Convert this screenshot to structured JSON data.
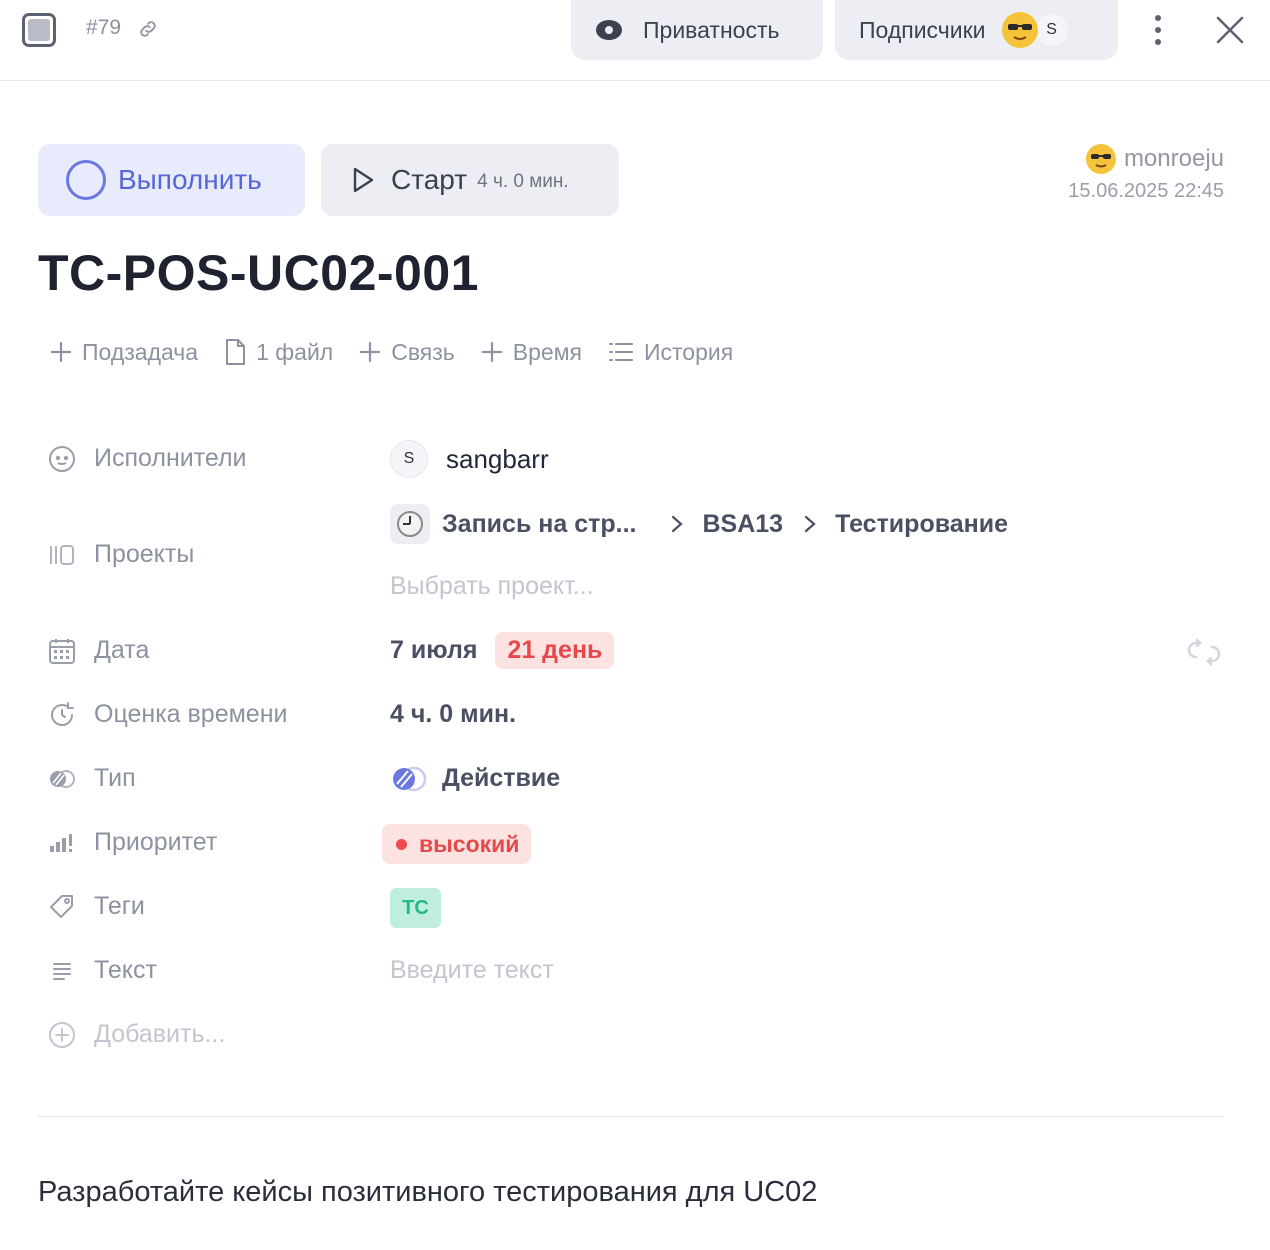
{
  "header": {
    "task_number": "#79",
    "privacy_label": "Приватность",
    "subscribers_label": "Подписчики",
    "subscriber_initial": "S"
  },
  "actions": {
    "complete_label": "Выполнить",
    "start_label": "Старт",
    "start_duration": "4 ч. 0 мин."
  },
  "author": {
    "name": "monroeju",
    "created_at": "15.06.2025 22:45"
  },
  "task": {
    "title": "TC-POS-UC02-001",
    "description": "Разработайте кейсы позитивного тестирования для UC02"
  },
  "toolbar": {
    "subtask": "Подзадача",
    "files": "1 файл",
    "link": "Связь",
    "time": "Время",
    "history": "История"
  },
  "properties": {
    "assignees": {
      "label": "Исполнители",
      "initial": "S",
      "name": "sangbarr"
    },
    "projects": {
      "label": "Проекты",
      "path": [
        "Запись на стр...",
        "BSA13",
        "Тестирование"
      ],
      "placeholder": "Выбрать проект..."
    },
    "date": {
      "label": "Дата",
      "value": "7 июля",
      "badge": "21 день"
    },
    "estimate": {
      "label": "Оценка времени",
      "value": "4 ч. 0 мин."
    },
    "type": {
      "label": "Тип",
      "value": "Действие"
    },
    "priority": {
      "label": "Приоритет",
      "value": "высокий"
    },
    "tags": {
      "label": "Теги",
      "value": "TC"
    },
    "text": {
      "label": "Текст",
      "placeholder": "Введите текст"
    },
    "add": {
      "label": "Добавить..."
    }
  },
  "colors": {
    "accent": "#5767d6",
    "danger": "#e5494c",
    "tag": "#24b887"
  }
}
